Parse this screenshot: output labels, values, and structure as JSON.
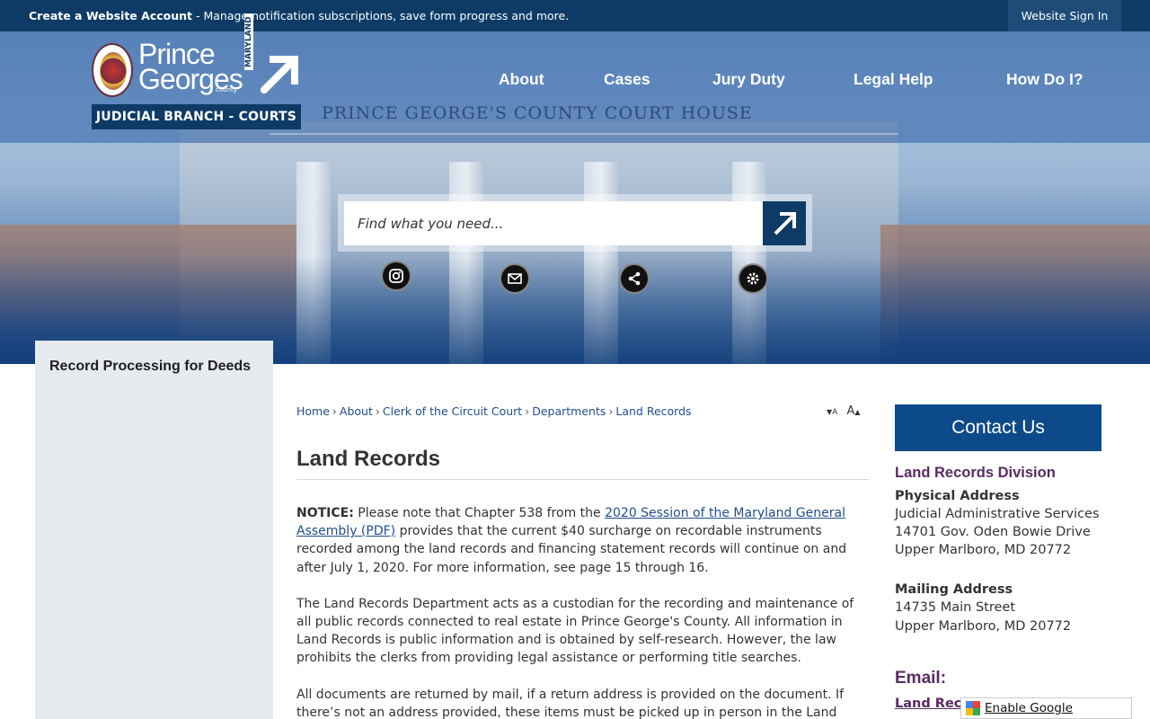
{
  "topbar": {
    "account_link": "Create a Website Account",
    "account_desc": " - Manage notification subscriptions, save form progress and more.",
    "signin": "Website Sign In"
  },
  "logo": {
    "line1": "Prince",
    "line2": "Georges",
    "county": "county",
    "state": "MARYLAND",
    "banner": "JUDICIAL BRANCH - COURTS"
  },
  "hero": {
    "building_sign": "PRINCE GEORGE'S COUNTY COURT HOUSE"
  },
  "nav": [
    "About",
    "Cases",
    "Jury Duty",
    "Legal Help",
    "How Do I?"
  ],
  "search": {
    "placeholder": "Find what you need..."
  },
  "social": [
    "instagram-icon",
    "email-icon",
    "share-icon",
    "settings-icon"
  ],
  "sidebar": {
    "items": [
      "Record Processing for Deeds"
    ]
  },
  "breadcrumb": [
    "Home",
    "About",
    "Clerk of the Circuit Court",
    "Departments",
    "Land Records"
  ],
  "font_resize": {
    "decrease": "A",
    "increase": "A"
  },
  "page": {
    "title": "Land Records",
    "notice_label": "NOTICE:",
    "notice_pre": " Please note that Chapter 538 from the ",
    "notice_link": "2020 Session of the Maryland General Assembly (PDF)",
    "notice_post": "  provides that the current $40 surcharge on recordable instruments recorded among the land records and financing statement records will continue on and after July 1, 2020. For more information, see page 15 through 16.",
    "para2": "The Land Records Department acts as a custodian for the recording and maintenance of all public records connected to real estate in Prince George's County. All information in Land Records is public information and is obtained by self-research. However, the law prohibits the clerks from providing legal assistance or performing title searches.",
    "para3": "All documents are returned by mail, if a return address is provided on the document. If there’s not an address provided, these items must be picked up in person in the Land"
  },
  "contact": {
    "button": "Contact Us",
    "division": "Land Records Division",
    "physical_label": "Physical Address",
    "physical": [
      "Judicial Administrative Services",
      "14701 Gov. Oden Bowie Drive",
      "Upper Marlboro, MD 20772"
    ],
    "mailing_label": "Mailing Address",
    "mailing": [
      "14735 Main Street",
      "Upper Marlboro, MD 20772"
    ],
    "email_label": "Email:",
    "email_link": "Land Records"
  },
  "translate": {
    "label": "Enable Google Translate"
  },
  "colors": {
    "brand": "#0d3b66",
    "accent": "#0d4a8a",
    "heading": "#5a2a63",
    "link": "#1f4e8c"
  }
}
